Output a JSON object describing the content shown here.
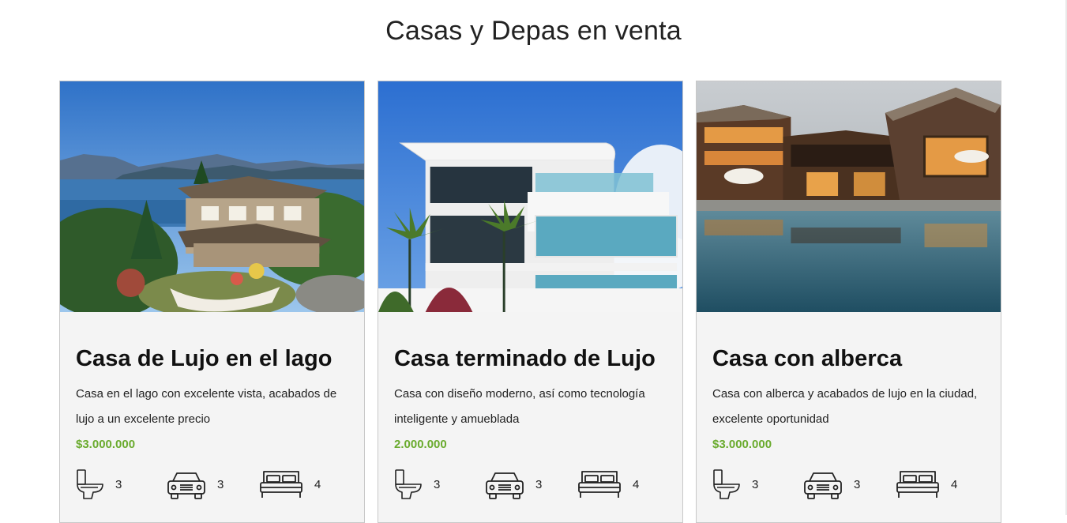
{
  "section": {
    "title": "Casas y Depas en venta"
  },
  "listings": [
    {
      "title": "Casa de Lujo en el lago",
      "description": "Casa en el lago con excelente vista, acabados de lujo a un excelente precio",
      "price": "$3.000.000",
      "bathrooms": "3",
      "parking": "3",
      "bedrooms": "4",
      "image": "lake-house-photo"
    },
    {
      "title": "Casa terminado de Lujo",
      "description": "Casa con diseño moderno, así como tecnología inteligente y amueblada",
      "price": "2.000.000",
      "bathrooms": "3",
      "parking": "3",
      "bedrooms": "4",
      "image": "modern-house-photo"
    },
    {
      "title": "Casa con alberca",
      "description": "Casa con alberca y acabados de lujo en la ciudad, excelente oportunidad",
      "price": "$3.000.000",
      "bathrooms": "3",
      "parking": "3",
      "bedrooms": "4",
      "image": "pool-house-photo"
    }
  ],
  "icons": {
    "bathroom": "toilet-icon",
    "parking": "car-icon",
    "bedroom": "bed-icon"
  },
  "colors": {
    "price": "#6aab2e",
    "card_bg": "#f4f4f4",
    "card_border": "#c8c8c8"
  }
}
